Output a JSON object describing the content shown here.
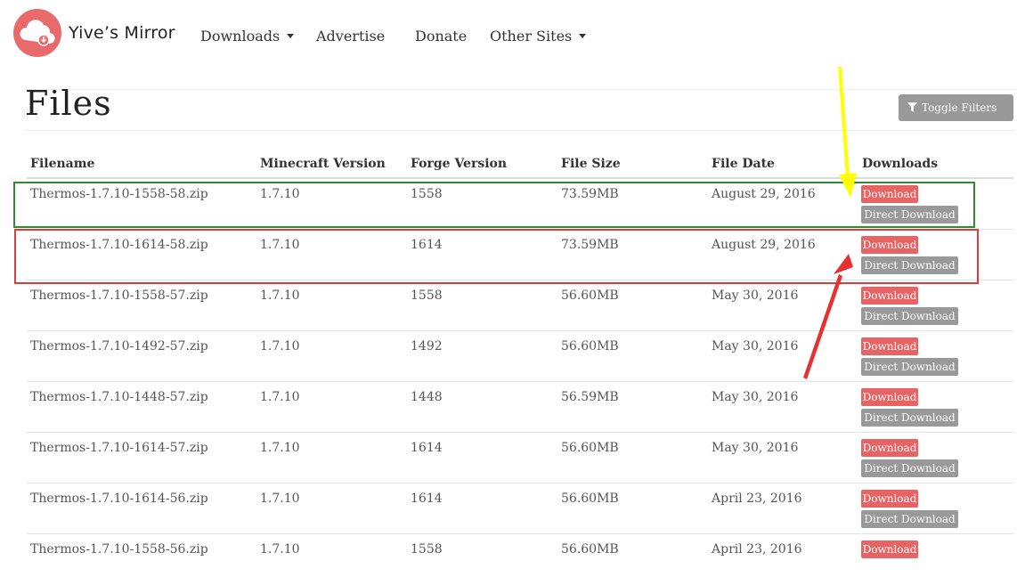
{
  "nav": {
    "brand": "Yive’s Mirror",
    "items": [
      {
        "label": "Downloads",
        "dropdown": true
      },
      {
        "label": "Advertise",
        "dropdown": false
      },
      {
        "label": "Donate",
        "dropdown": false
      },
      {
        "label": "Other Sites",
        "dropdown": true
      }
    ]
  },
  "page": {
    "title": "Files",
    "toggle_filters": "Toggle Filters"
  },
  "table": {
    "headers": [
      "Filename",
      "Minecraft Version",
      "Forge Version",
      "File Size",
      "File Date",
      "Downloads"
    ],
    "download_label": "Download",
    "direct_download_label": "Direct Download",
    "rows": [
      {
        "filename": "Thermos-1.7.10-1558-58.zip",
        "mc": "1.7.10",
        "forge": "1558",
        "size": "73.59MB",
        "date": "August 29, 2016"
      },
      {
        "filename": "Thermos-1.7.10-1614-58.zip",
        "mc": "1.7.10",
        "forge": "1614",
        "size": "73.59MB",
        "date": "August 29, 2016"
      },
      {
        "filename": "Thermos-1.7.10-1558-57.zip",
        "mc": "1.7.10",
        "forge": "1558",
        "size": "56.60MB",
        "date": "May 30, 2016"
      },
      {
        "filename": "Thermos-1.7.10-1492-57.zip",
        "mc": "1.7.10",
        "forge": "1492",
        "size": "56.60MB",
        "date": "May 30, 2016"
      },
      {
        "filename": "Thermos-1.7.10-1448-57.zip",
        "mc": "1.7.10",
        "forge": "1448",
        "size": "56.59MB",
        "date": "May 30, 2016"
      },
      {
        "filename": "Thermos-1.7.10-1614-57.zip",
        "mc": "1.7.10",
        "forge": "1614",
        "size": "56.60MB",
        "date": "May 30, 2016"
      },
      {
        "filename": "Thermos-1.7.10-1614-56.zip",
        "mc": "1.7.10",
        "forge": "1614",
        "size": "56.60MB",
        "date": "April 23, 2016"
      },
      {
        "filename": "Thermos-1.7.10-1558-56.zip",
        "mc": "1.7.10",
        "forge": "1558",
        "size": "56.60MB",
        "date": "April 23, 2016"
      }
    ]
  },
  "icons": {
    "logo": "cloud-download-icon",
    "filter": "filter-icon",
    "caret": "caret-down-icon"
  },
  "colors": {
    "logo": "#e86a6a",
    "download_button": "#e86363",
    "direct_button": "#999999",
    "highlight_green": "#2e8b2e",
    "highlight_red": "#e03b3b",
    "arrow_yellow": "#ffff00",
    "arrow_red": "#e83030"
  }
}
